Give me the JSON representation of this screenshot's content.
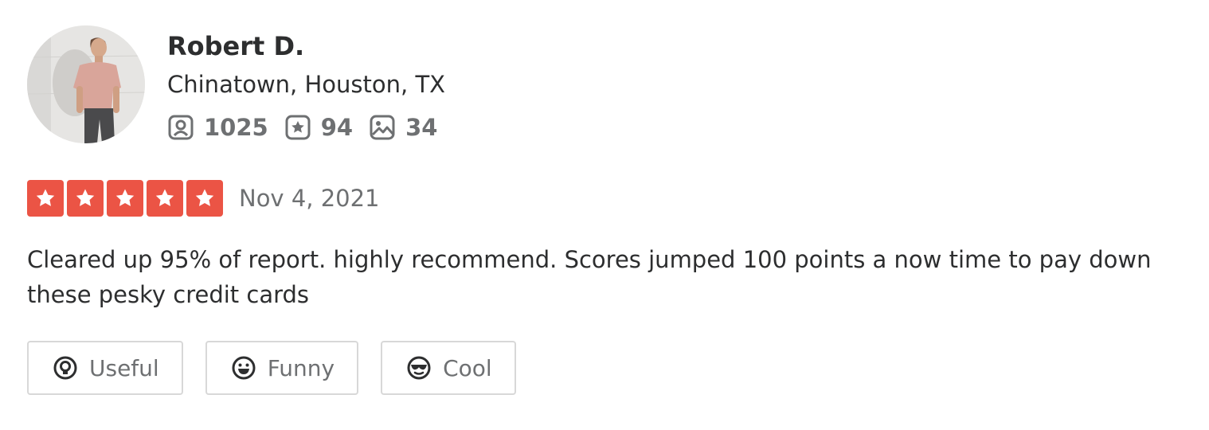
{
  "user": {
    "name": "Robert D.",
    "location": "Chinatown, Houston, TX",
    "stats": {
      "friends": {
        "icon": "friends-icon",
        "value": "1025"
      },
      "reviews": {
        "icon": "review-star-icon",
        "value": "94"
      },
      "photos": {
        "icon": "photo-icon",
        "value": "34"
      }
    }
  },
  "review": {
    "rating": 5,
    "rating_max": 5,
    "star_color": "#eb5445",
    "date": "Nov 4, 2021",
    "text": "Cleared up 95% of report. highly recommend. Scores jumped 100 points a now time to pay down these pesky credit cards"
  },
  "reactions": [
    {
      "label": "Useful",
      "icon": "lightbulb-icon"
    },
    {
      "label": "Funny",
      "icon": "smiley-icon"
    },
    {
      "label": "Cool",
      "icon": "sunglasses-icon"
    }
  ]
}
